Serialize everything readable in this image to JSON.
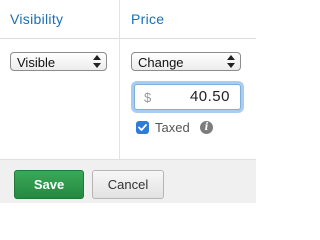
{
  "columns": {
    "visibility": {
      "header": "Visibility",
      "select_value": "Visible"
    },
    "price": {
      "header": "Price",
      "select_value": "Change",
      "currency_symbol": "$",
      "amount": "40.50",
      "taxed_label": "Taxed",
      "taxed_checked": true
    }
  },
  "footer": {
    "save_label": "Save",
    "cancel_label": "Cancel"
  },
  "colors": {
    "header_text": "#1a6fb5",
    "save_button": "#2a9a4a",
    "checkbox": "#2f7bd6",
    "focus_ring": "#a8cdf0"
  },
  "icons": {
    "select_arrows": "up-down-chevrons",
    "checkbox_mark": "check-icon",
    "info": "info-icon"
  }
}
